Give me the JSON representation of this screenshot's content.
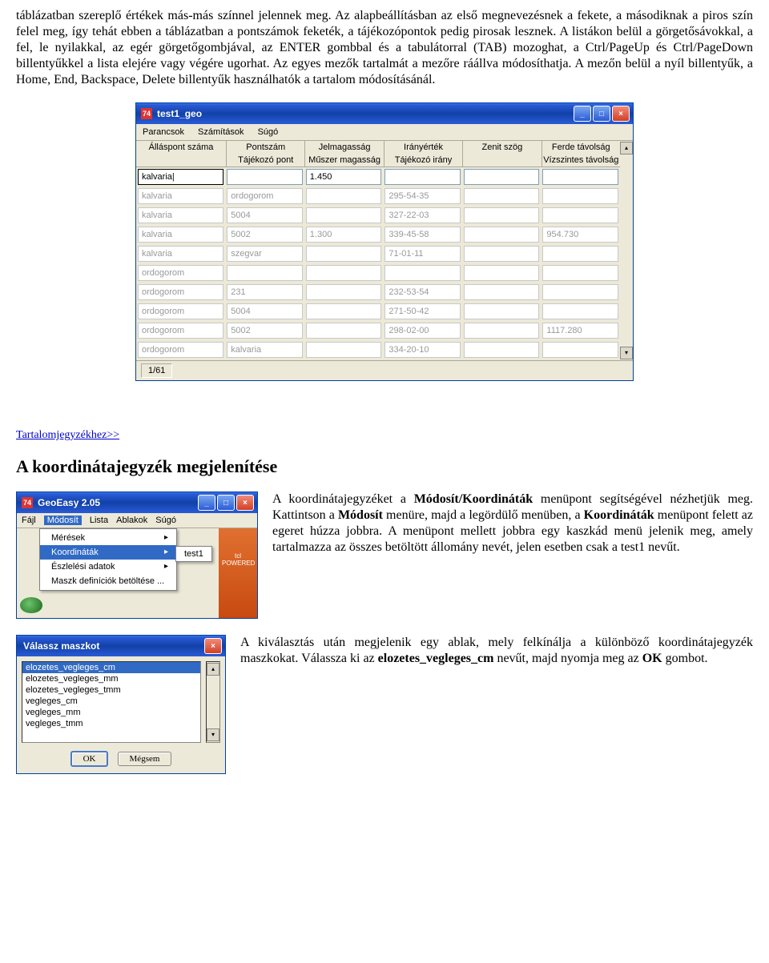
{
  "para1": "táblázatban szereplő értékek más-más színnel jelennek meg. Az alapbeállításban az első megnevezésnek a fekete, a másodiknak a piros szín felel meg, így tehát ebben a táblázatban a pontszámok feketék, a tájékozópontok pedig pirosak lesznek. A listákon belül a görgetősávokkal, a fel, le nyilakkal, az egér görgetőgombjával, az ENTER gombbal és a tabulátorral (TAB) mozoghat, a Ctrl/PageUp és Ctrl/PageDown billentyűkkel a lista elejére vagy végére ugorhat. Az egyes mezők tartalmát a mezőre ráállva módosíthatja. A mezőn belül a nyíl billentyűk, a Home, End, Backspace, Delete billentyűk használhatók a tartalom módosításánál.",
  "geo": {
    "title": "test1_geo",
    "menu": [
      "Parancsok",
      "Számítások",
      "Súgó"
    ],
    "head1": [
      "Álláspont száma",
      "Pontszám",
      "Jelmagasság",
      "Irányérték",
      "Zenit szög",
      "Ferde távolság"
    ],
    "head2": [
      "",
      "Tájékozó pont",
      "Műszer magasság",
      "Tájékozó irány",
      "",
      "Vízszintes távolság"
    ],
    "rows": [
      {
        "c": [
          "kalvaria|",
          "",
          "1.450",
          "",
          "",
          ""
        ],
        "active": 0
      },
      {
        "c": [
          "kalvaria",
          "ordogorom",
          "",
          "295-54-35",
          "",
          ""
        ],
        "red": [
          1,
          3
        ],
        "pale": true
      },
      {
        "c": [
          "kalvaria",
          "5004",
          "",
          "327-22-03",
          "",
          ""
        ],
        "red": [
          3
        ],
        "pale": true
      },
      {
        "c": [
          "kalvaria",
          "5002",
          "1.300",
          "339-45-58",
          "",
          "954.730"
        ],
        "red": [
          3,
          5
        ],
        "pale": true
      },
      {
        "c": [
          "kalvaria",
          "szegvar",
          "",
          "71-01-11",
          "",
          ""
        ],
        "red": [
          1,
          3
        ],
        "pale": true
      },
      {
        "c": [
          "ordogorom",
          "",
          "",
          "",
          "",
          ""
        ],
        "pale": true
      },
      {
        "c": [
          "ordogorom",
          "231",
          "",
          "232-53-54",
          "",
          ""
        ],
        "red": [
          3
        ],
        "pale": true
      },
      {
        "c": [
          "ordogorom",
          "5004",
          "",
          "271-50-42",
          "",
          ""
        ],
        "red": [
          3
        ],
        "pale": true
      },
      {
        "c": [
          "ordogorom",
          "5002",
          "",
          "298-02-00",
          "",
          "1117.280"
        ],
        "red": [
          3,
          5
        ],
        "pale": true
      },
      {
        "c": [
          "ordogorom",
          "kalvaria",
          "",
          "334-20-10",
          "",
          ""
        ],
        "red": [
          1,
          3
        ],
        "pale": true
      }
    ],
    "status": "1/61"
  },
  "toc_link": "Tartalomjegyzékhez>>",
  "section_title": "A koordinátajegyzék megjelenítése",
  "menuwin": {
    "title": "GeoEasy 2.05",
    "bar": [
      "Fájl",
      "Módosít",
      "Lista",
      "Ablakok",
      "Súgó"
    ],
    "hi": "Módosít",
    "drop": [
      {
        "label": "Mérések",
        "arrow": true
      },
      {
        "label": "Koordináták",
        "arrow": true,
        "hi": true
      },
      {
        "label": "Észlelési adatok",
        "arrow": true
      },
      {
        "label": "Maszk definíciók betöltése ..."
      }
    ],
    "sub": "test1"
  },
  "para2a": "A koordinátajegyzéket a ",
  "para2b": "Módosít/Koordináták",
  "para2c": " menüpont segítségével nézhetjük meg. Kattintson a ",
  "para2d": "Módosít",
  "para2e": " menüre, majd a legördülő menüben, a ",
  "para2f": "Koordináták",
  "para2g": " menüpont felett az egeret húzza jobbra. A menüpont mellett jobbra egy kaszkád menü jelenik meg, amely tartalmazza az összes betöltött állomány nevét, jelen esetben csak a test1 nevűt.",
  "mask": {
    "title": "Válassz maszkot",
    "items": [
      "elozetes_vegleges_cm",
      "elozetes_vegleges_mm",
      "elozetes_vegleges_tmm",
      "vegleges_cm",
      "vegleges_mm",
      "vegleges_tmm"
    ],
    "sel": 0,
    "ok": "OK",
    "cancel": "Mégsem"
  },
  "para3a": "A kiválasztás után megjelenik egy ablak, mely felkínálja a különböző koordinátajegyzék maszkokat. Válassza ki az ",
  "para3b": "elozetes_vegleges_cm",
  "para3c": " nevűt, majd nyomja meg az ",
  "para3d": "OK",
  "para3e": " gombot."
}
